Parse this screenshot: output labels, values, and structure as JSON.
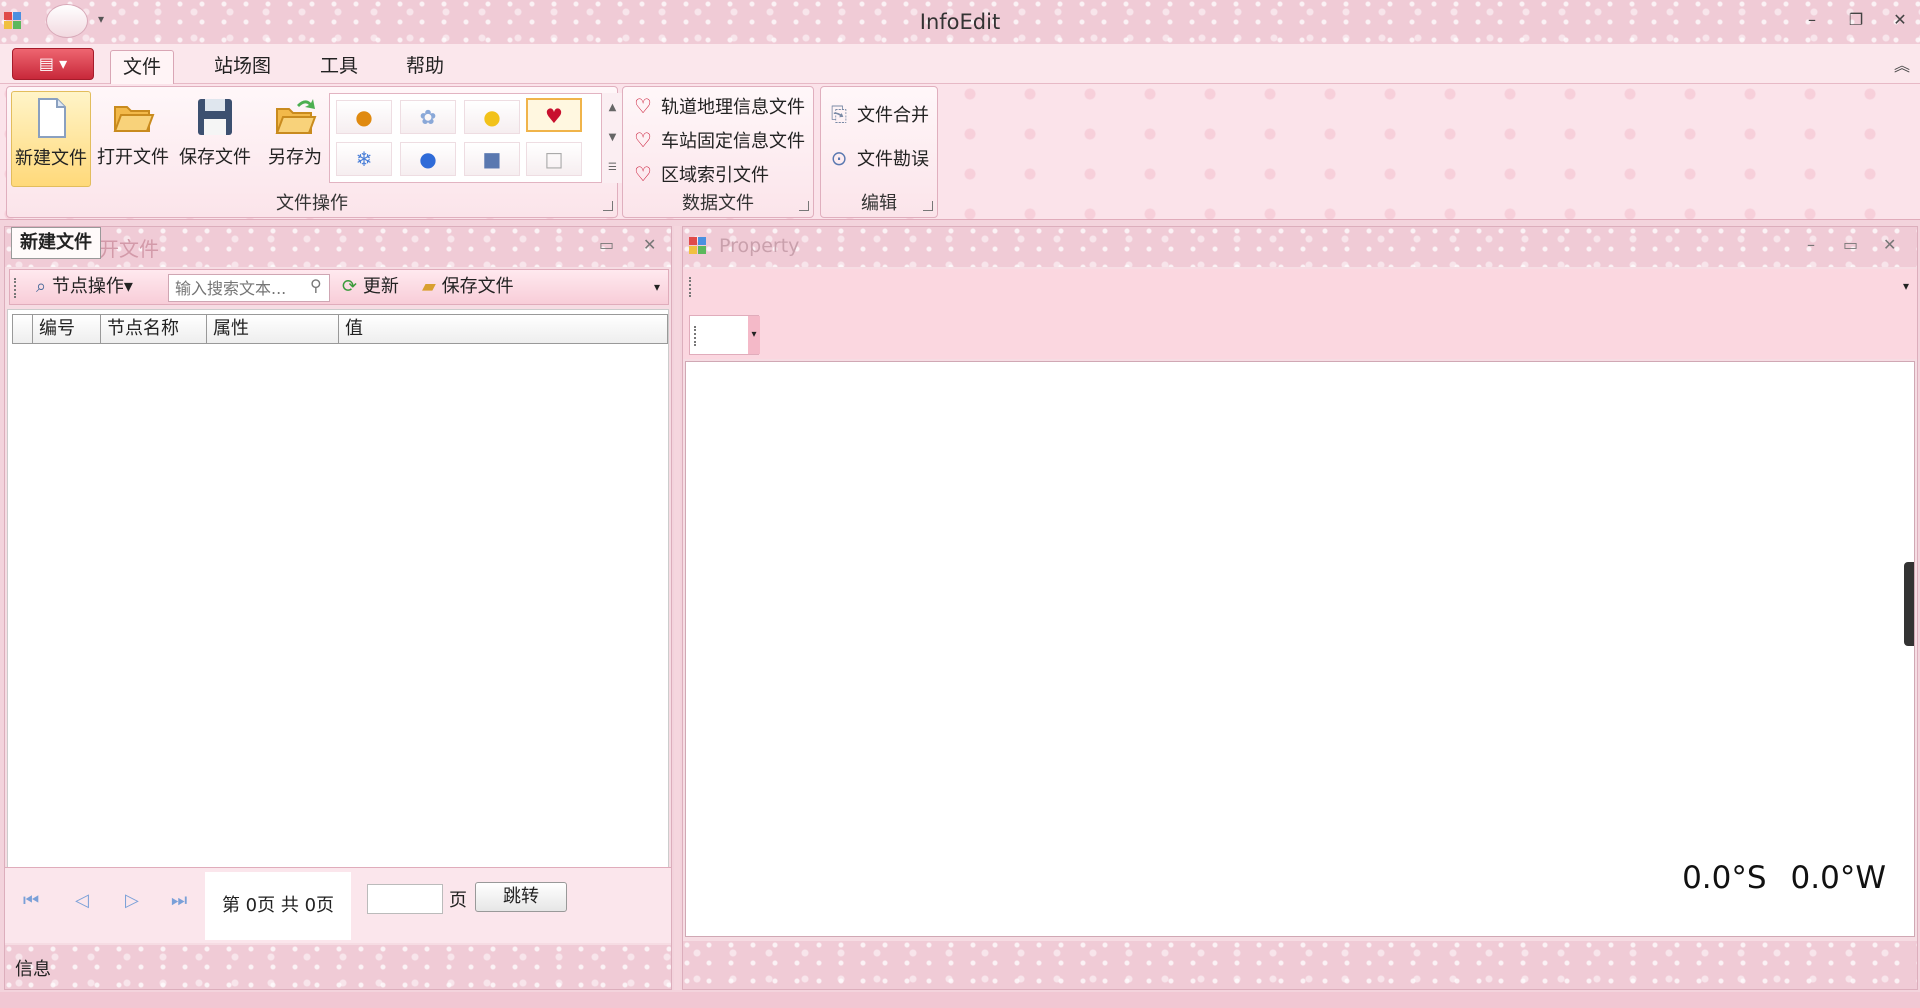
{
  "window": {
    "title": "InfoEdit",
    "controls": [
      "–",
      "❐",
      "✕"
    ]
  },
  "menubar": {
    "app_button": "▤ ▾",
    "tabs": [
      "文件",
      "站场图",
      "工具",
      "帮助"
    ],
    "collapse": "︽"
  },
  "ribbon": {
    "file_ops": {
      "label": "文件操作",
      "buttons": [
        "新建文件",
        "打开文件",
        "保存文件",
        "另存为"
      ]
    },
    "gallery": {
      "items": [
        "●",
        "✿",
        "●",
        "♥",
        "❄",
        "●",
        "■",
        "□"
      ],
      "selected": 3
    },
    "data_files": {
      "label": "数据文件",
      "items": [
        "轨道地理信息文件",
        "车站固定信息文件",
        "区域索引文件"
      ]
    },
    "edit": {
      "label": "编辑",
      "items": [
        "文件合并",
        "文件勘误"
      ]
    }
  },
  "left_panel": {
    "active_tab": "新建文件",
    "ghost_tab": "开文件",
    "toolbar": {
      "node_ops": "节点操作▾",
      "search_placeholder": "输入搜索文本...",
      "refresh": "更新",
      "save": "保存文件"
    },
    "columns": [
      "编号",
      "节点名称",
      "属性",
      "值"
    ],
    "pager": {
      "page_info": "第 0页  共 0页",
      "page_unit": "页",
      "jump": "跳转"
    },
    "status_label": "信息"
  },
  "right_panel": {
    "title": "Property",
    "coords": {
      "lat": "0.0°S",
      "lon": "0.0°W"
    }
  }
}
